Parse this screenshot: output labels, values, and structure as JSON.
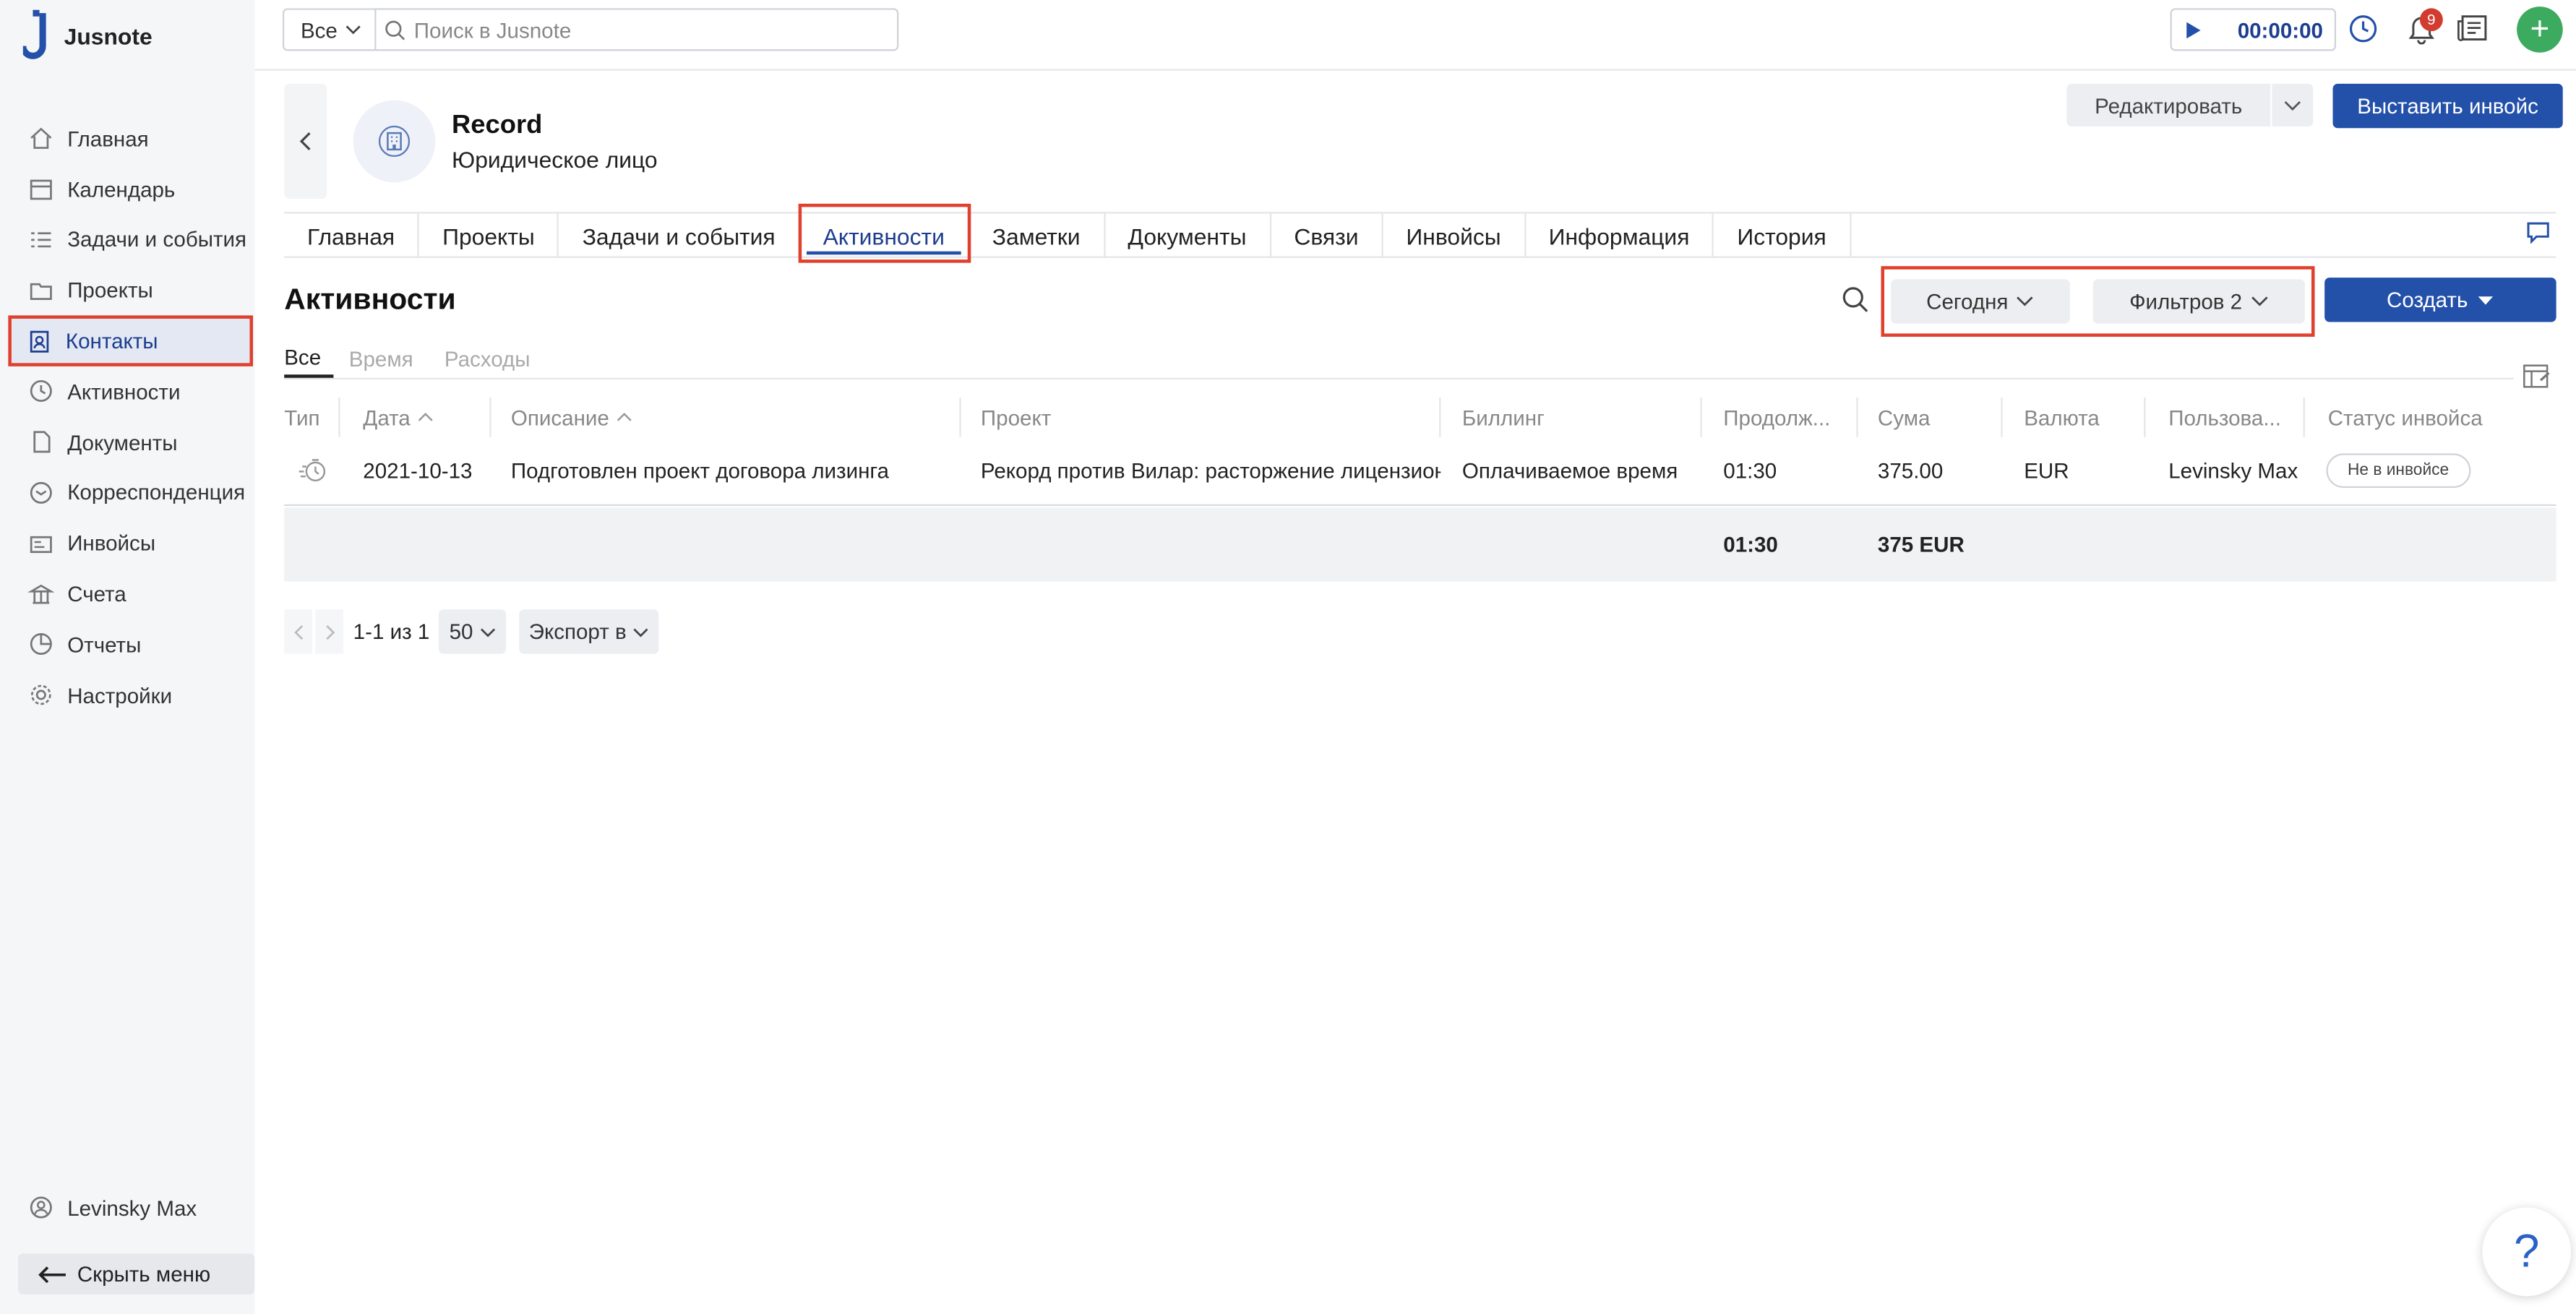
{
  "app": {
    "name": "Jusnote"
  },
  "sidebar": {
    "items": [
      {
        "label": "Главная",
        "icon": "home-icon"
      },
      {
        "label": "Календарь",
        "icon": "calendar-icon"
      },
      {
        "label": "Задачи и события",
        "icon": "tasks-icon"
      },
      {
        "label": "Проекты",
        "icon": "projects-icon"
      },
      {
        "label": "Контакты",
        "icon": "contacts-icon",
        "active": true
      },
      {
        "label": "Активности",
        "icon": "activities-icon"
      },
      {
        "label": "Документы",
        "icon": "documents-icon"
      },
      {
        "label": "Корреспонденция",
        "icon": "correspondence-icon"
      },
      {
        "label": "Инвойсы",
        "icon": "invoices-icon"
      },
      {
        "label": "Счета",
        "icon": "accounts-icon"
      },
      {
        "label": "Отчеты",
        "icon": "reports-icon"
      },
      {
        "label": "Настройки",
        "icon": "settings-icon"
      }
    ],
    "user": "Levinsky Max",
    "hide_menu": "Скрыть меню"
  },
  "topbar": {
    "scope": "Все",
    "search_placeholder": "Поиск в Jusnote",
    "timer": "00:00:00",
    "notifications_count": "9"
  },
  "entity": {
    "name": "Record",
    "type": "Юридическое лицо",
    "edit_label": "Редактировать",
    "invoice_label": "Выставить инвойс"
  },
  "tabs": [
    "Главная",
    "Проекты",
    "Задачи и события",
    "Активности",
    "Заметки",
    "Документы",
    "Связи",
    "Инвойсы",
    "Информация",
    "История"
  ],
  "active_tab": "Активности",
  "section": {
    "title": "Активности",
    "date_filter": "Сегодня",
    "filters": "Фильтров 2",
    "create": "Создать"
  },
  "subtabs": [
    "Все",
    "Время",
    "Расходы"
  ],
  "table": {
    "columns": [
      "Тип",
      "Дата",
      "Описание",
      "Проект",
      "Биллинг",
      "Продолж...",
      "Сума",
      "Валюта",
      "Пользова...",
      "Статус инвойса"
    ],
    "rows": [
      {
        "type_icon": "time-entry-icon",
        "date": "2021-10-13",
        "description": "Подготовлен проект договора лизинга",
        "project": "Рекорд против Вилар: расторжение лицензионного",
        "billing": "Оплачиваемое время",
        "duration": "01:30",
        "amount": "375.00",
        "currency": "EUR",
        "user": "Levinsky Max",
        "invoice_status": "Не в инвойсе"
      }
    ],
    "totals": {
      "duration": "01:30",
      "amount": "375 EUR"
    }
  },
  "pagination": {
    "range": "1-1 из 1",
    "page_size": "50",
    "export": "Экспорт в"
  },
  "help": "?",
  "colors": {
    "accent": "#2350a9",
    "highlight": "#e0412e",
    "add": "#3caa5f",
    "badge": "#d23b2f"
  }
}
